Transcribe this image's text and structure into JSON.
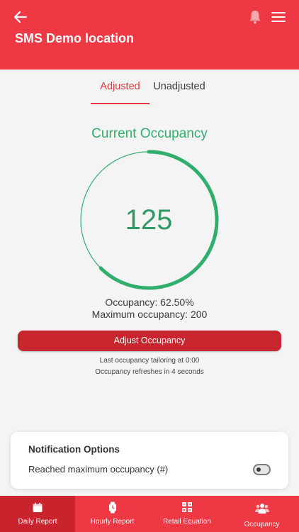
{
  "header": {
    "title": "SMS Demo location",
    "back_icon": "arrow-left-icon",
    "bell_icon": "bell-icon",
    "menu_icon": "hamburger-menu-icon",
    "background_color": "#ee3843"
  },
  "tabs": [
    {
      "label": "Adjusted",
      "active": true
    },
    {
      "label": "Unadjusted",
      "active": false
    }
  ],
  "occupancy": {
    "title": "Current Occupancy",
    "current": "125",
    "fraction": 0.625,
    "occupancy_text": "Occupancy: 62.50%",
    "maximum_text": "Maximum occupancy: 200",
    "gauge_color": "#2fae6c"
  },
  "adjust_button": {
    "label": "Adjust Occupancy",
    "color": "#c8262f"
  },
  "info": {
    "tailoring": "Last occupancy tailoring at 0:00",
    "refresh": "Occupancy refreshes in 4 seconds"
  },
  "notification": {
    "title": "Notification Options",
    "option_label": "Reached maximum occupancy (#)",
    "toggle_on": false
  },
  "bottom_nav": [
    {
      "label": "Daily Report",
      "icon": "calendar-icon",
      "active": true
    },
    {
      "label": "Hourly Report",
      "icon": "watch-icon",
      "active": false
    },
    {
      "label": "Retail Equation",
      "icon": "grid-icon",
      "active": false
    },
    {
      "label": "Occupancy",
      "icon": "people-icon",
      "active": false
    }
  ]
}
